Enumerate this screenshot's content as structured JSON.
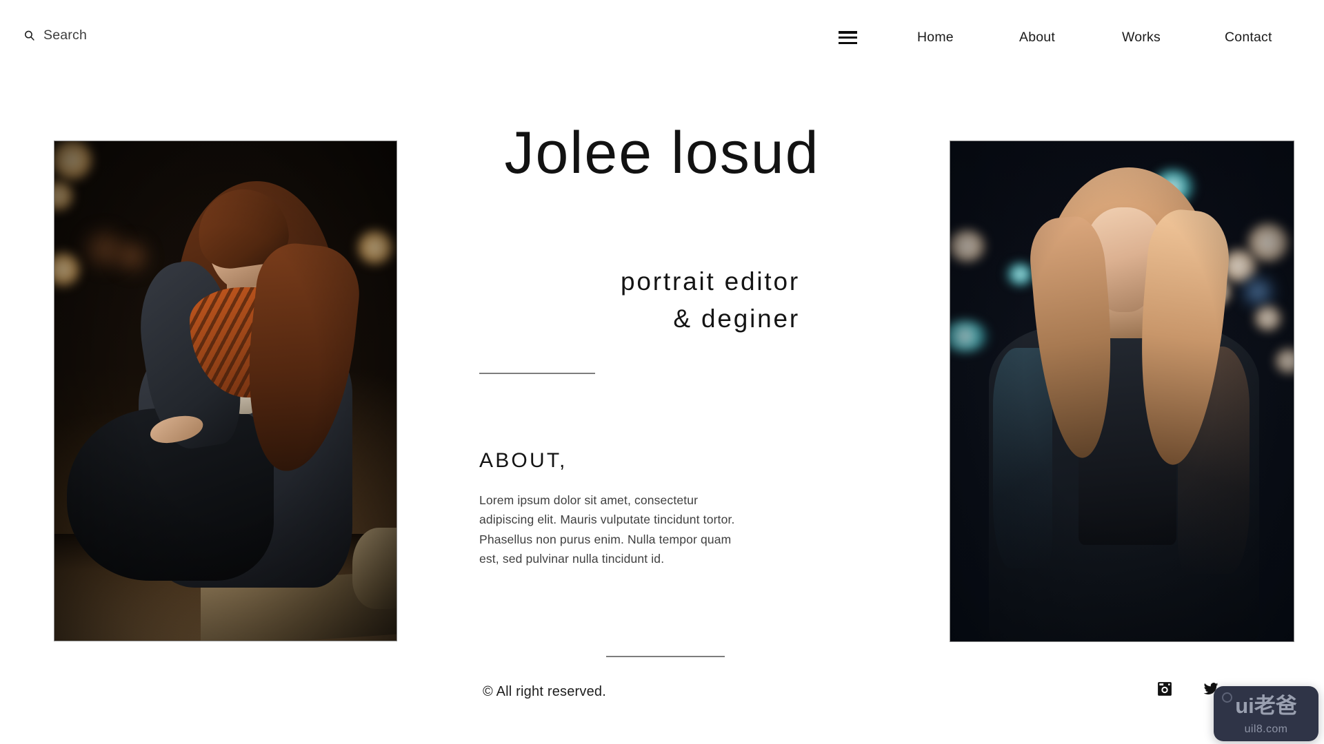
{
  "header": {
    "search": {
      "placeholder": "Search",
      "value": "",
      "icon": "search-icon"
    },
    "menu_icon": "hamburger-menu-icon",
    "nav": [
      {
        "label": "Home"
      },
      {
        "label": "About"
      },
      {
        "label": "Works"
      },
      {
        "label": "Contact"
      }
    ]
  },
  "hero": {
    "title": "Jolee  losud",
    "subtitle_line1": "portrait editor",
    "subtitle_line2": "& deginer"
  },
  "about": {
    "heading": "ABOUT,",
    "body": "Lorem ipsum dolor sit amet, consectetur adipiscing elit. Mauris vulputate tincidunt tortor. Phasellus non purus enim. Nulla tempor quam est, sed pulvinar nulla tincidunt id."
  },
  "gallery": {
    "left": {
      "alt": "Young woman with auburn hair in dark grey sweater and rust orange scarf sitting on concrete at night",
      "border_color": "#8a8a8a"
    },
    "right": {
      "alt": "Blonde woman in black leather jacket standing in front of city bokeh lights at night",
      "border_color": "#8a8a8a"
    }
  },
  "footer": {
    "copyright": "© All right reserved.",
    "social": [
      {
        "name": "instagram",
        "label": "Instagram"
      },
      {
        "name": "twitter",
        "label": "Twitter"
      }
    ]
  },
  "watermark": {
    "main": "ui老爸",
    "sub": "uil8.com",
    "background_color": "#2f3447",
    "text_color": "#9aa0b0"
  },
  "theme": {
    "background": "#ffffff",
    "text": "#1a1a1a",
    "muted_text": "#3f3f3f",
    "divider": "#7d7d7d"
  }
}
